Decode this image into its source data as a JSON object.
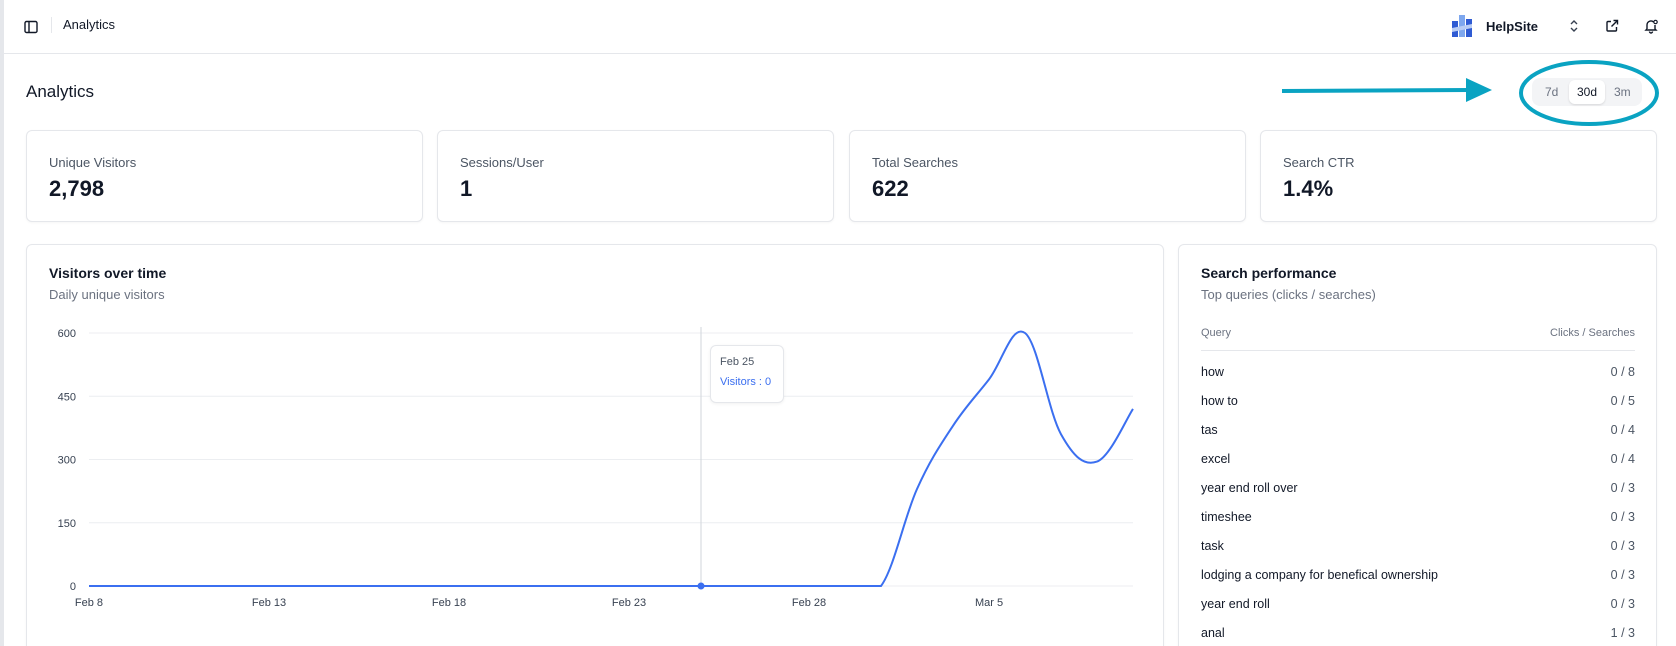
{
  "topbar": {
    "breadcrumb": "Analytics",
    "brand_name": "HelpSite"
  },
  "page": {
    "title": "Analytics",
    "ranges": [
      {
        "label": "7d",
        "active": false
      },
      {
        "label": "30d",
        "active": true
      },
      {
        "label": "3m",
        "active": false
      }
    ]
  },
  "stats": [
    {
      "label": "Unique Visitors",
      "value": "2,798"
    },
    {
      "label": "Sessions/User",
      "value": "1"
    },
    {
      "label": "Total Searches",
      "value": "622"
    },
    {
      "label": "Search CTR",
      "value": "1.4%"
    }
  ],
  "visitors_panel": {
    "title": "Visitors over time",
    "subtitle": "Daily unique visitors",
    "tooltip": {
      "date": "Feb 25",
      "text": "Visitors : 0"
    }
  },
  "search_panel": {
    "title": "Search performance",
    "subtitle": "Top queries (clicks / searches)",
    "col_query": "Query",
    "col_ratio": "Clicks / Searches",
    "rows": [
      {
        "query": "how",
        "ratio": "0 / 8"
      },
      {
        "query": "how to",
        "ratio": "0 / 5"
      },
      {
        "query": "tas",
        "ratio": "0 / 4"
      },
      {
        "query": "excel",
        "ratio": "0 / 4"
      },
      {
        "query": "year end roll over",
        "ratio": "0 / 3"
      },
      {
        "query": "timeshee",
        "ratio": "0 / 3"
      },
      {
        "query": "task",
        "ratio": "0 / 3"
      },
      {
        "query": "lodging a company for benefical ownership",
        "ratio": "0 / 3"
      },
      {
        "query": "year end roll",
        "ratio": "0 / 3"
      },
      {
        "query": "anal",
        "ratio": "1 / 3"
      }
    ]
  },
  "colors": {
    "accent": "#3b6ff0",
    "annotation": "#0aa3c2",
    "border": "#e5e7eb"
  },
  "icons": [
    "sidebar-toggle-icon",
    "helpsite-logo-icon",
    "chevron-up-down-icon",
    "external-link-icon",
    "bell-icon"
  ],
  "chart_data": {
    "type": "line",
    "ylabel": "",
    "xlabel": "",
    "ylim": [
      0,
      600
    ],
    "yticks": [
      0,
      150,
      300,
      450,
      600
    ],
    "xticks": [
      "Feb 8",
      "Feb 13",
      "Feb 18",
      "Feb 23",
      "Feb 28",
      "Mar 5"
    ],
    "grid": true,
    "x": [
      "Feb 8",
      "Feb 9",
      "Feb 10",
      "Feb 11",
      "Feb 12",
      "Feb 13",
      "Feb 14",
      "Feb 15",
      "Feb 16",
      "Feb 17",
      "Feb 18",
      "Feb 19",
      "Feb 20",
      "Feb 21",
      "Feb 22",
      "Feb 23",
      "Feb 24",
      "Feb 25",
      "Feb 26",
      "Feb 27",
      "Feb 28",
      "Mar 1",
      "Mar 2",
      "Mar 3",
      "Mar 4",
      "Mar 5",
      "Mar 6",
      "Mar 7",
      "Mar 8",
      "Mar 9"
    ],
    "series": [
      {
        "values": [
          0,
          0,
          0,
          0,
          0,
          0,
          0,
          0,
          0,
          0,
          0,
          0,
          0,
          0,
          0,
          0,
          0,
          0,
          0,
          0,
          0,
          0,
          0,
          230,
          380,
          490,
          600,
          360,
          295,
          420
        ]
      }
    ],
    "highlight": {
      "x": "Feb 25",
      "value": 0
    }
  }
}
